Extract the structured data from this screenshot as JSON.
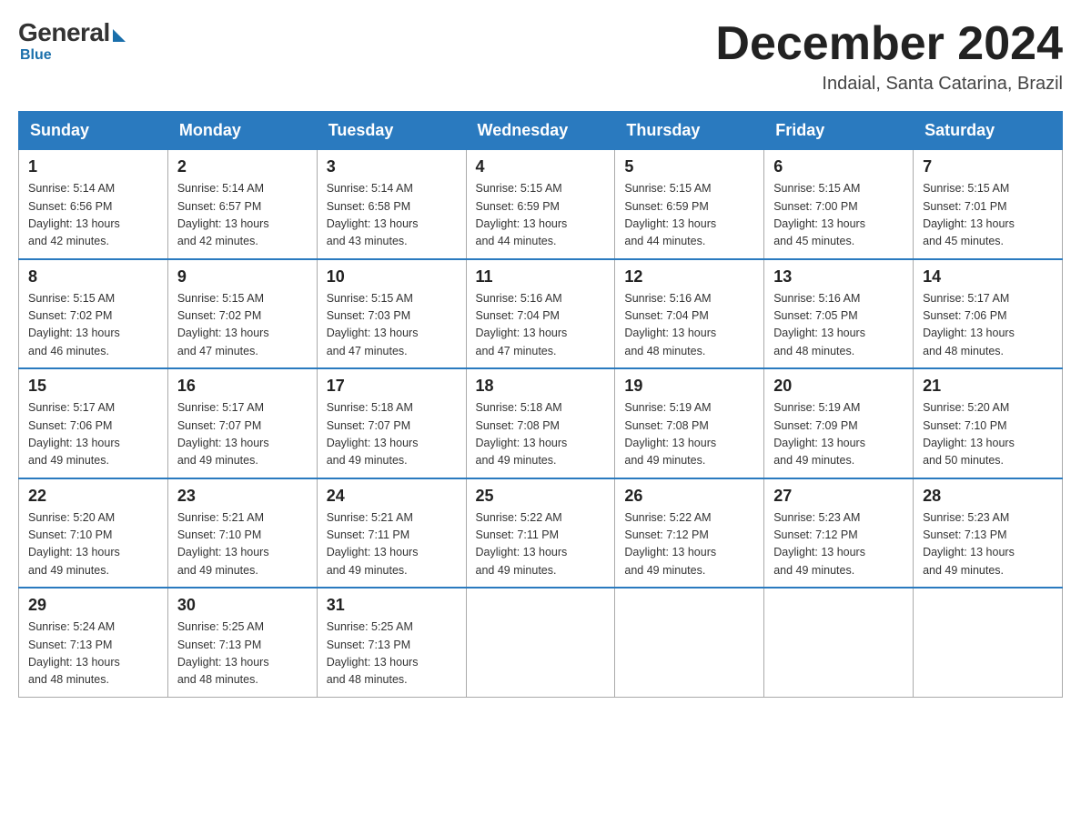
{
  "header": {
    "logo_general": "General",
    "logo_blue": "Blue",
    "month_title": "December 2024",
    "location": "Indaial, Santa Catarina, Brazil"
  },
  "days_of_week": [
    "Sunday",
    "Monday",
    "Tuesday",
    "Wednesday",
    "Thursday",
    "Friday",
    "Saturday"
  ],
  "weeks": [
    [
      {
        "day": "1",
        "sunrise": "5:14 AM",
        "sunset": "6:56 PM",
        "daylight": "13 hours and 42 minutes."
      },
      {
        "day": "2",
        "sunrise": "5:14 AM",
        "sunset": "6:57 PM",
        "daylight": "13 hours and 42 minutes."
      },
      {
        "day": "3",
        "sunrise": "5:14 AM",
        "sunset": "6:58 PM",
        "daylight": "13 hours and 43 minutes."
      },
      {
        "day": "4",
        "sunrise": "5:15 AM",
        "sunset": "6:59 PM",
        "daylight": "13 hours and 44 minutes."
      },
      {
        "day": "5",
        "sunrise": "5:15 AM",
        "sunset": "6:59 PM",
        "daylight": "13 hours and 44 minutes."
      },
      {
        "day": "6",
        "sunrise": "5:15 AM",
        "sunset": "7:00 PM",
        "daylight": "13 hours and 45 minutes."
      },
      {
        "day": "7",
        "sunrise": "5:15 AM",
        "sunset": "7:01 PM",
        "daylight": "13 hours and 45 minutes."
      }
    ],
    [
      {
        "day": "8",
        "sunrise": "5:15 AM",
        "sunset": "7:02 PM",
        "daylight": "13 hours and 46 minutes."
      },
      {
        "day": "9",
        "sunrise": "5:15 AM",
        "sunset": "7:02 PM",
        "daylight": "13 hours and 47 minutes."
      },
      {
        "day": "10",
        "sunrise": "5:15 AM",
        "sunset": "7:03 PM",
        "daylight": "13 hours and 47 minutes."
      },
      {
        "day": "11",
        "sunrise": "5:16 AM",
        "sunset": "7:04 PM",
        "daylight": "13 hours and 47 minutes."
      },
      {
        "day": "12",
        "sunrise": "5:16 AM",
        "sunset": "7:04 PM",
        "daylight": "13 hours and 48 minutes."
      },
      {
        "day": "13",
        "sunrise": "5:16 AM",
        "sunset": "7:05 PM",
        "daylight": "13 hours and 48 minutes."
      },
      {
        "day": "14",
        "sunrise": "5:17 AM",
        "sunset": "7:06 PM",
        "daylight": "13 hours and 48 minutes."
      }
    ],
    [
      {
        "day": "15",
        "sunrise": "5:17 AM",
        "sunset": "7:06 PM",
        "daylight": "13 hours and 49 minutes."
      },
      {
        "day": "16",
        "sunrise": "5:17 AM",
        "sunset": "7:07 PM",
        "daylight": "13 hours and 49 minutes."
      },
      {
        "day": "17",
        "sunrise": "5:18 AM",
        "sunset": "7:07 PM",
        "daylight": "13 hours and 49 minutes."
      },
      {
        "day": "18",
        "sunrise": "5:18 AM",
        "sunset": "7:08 PM",
        "daylight": "13 hours and 49 minutes."
      },
      {
        "day": "19",
        "sunrise": "5:19 AM",
        "sunset": "7:08 PM",
        "daylight": "13 hours and 49 minutes."
      },
      {
        "day": "20",
        "sunrise": "5:19 AM",
        "sunset": "7:09 PM",
        "daylight": "13 hours and 49 minutes."
      },
      {
        "day": "21",
        "sunrise": "5:20 AM",
        "sunset": "7:10 PM",
        "daylight": "13 hours and 50 minutes."
      }
    ],
    [
      {
        "day": "22",
        "sunrise": "5:20 AM",
        "sunset": "7:10 PM",
        "daylight": "13 hours and 49 minutes."
      },
      {
        "day": "23",
        "sunrise": "5:21 AM",
        "sunset": "7:10 PM",
        "daylight": "13 hours and 49 minutes."
      },
      {
        "day": "24",
        "sunrise": "5:21 AM",
        "sunset": "7:11 PM",
        "daylight": "13 hours and 49 minutes."
      },
      {
        "day": "25",
        "sunrise": "5:22 AM",
        "sunset": "7:11 PM",
        "daylight": "13 hours and 49 minutes."
      },
      {
        "day": "26",
        "sunrise": "5:22 AM",
        "sunset": "7:12 PM",
        "daylight": "13 hours and 49 minutes."
      },
      {
        "day": "27",
        "sunrise": "5:23 AM",
        "sunset": "7:12 PM",
        "daylight": "13 hours and 49 minutes."
      },
      {
        "day": "28",
        "sunrise": "5:23 AM",
        "sunset": "7:13 PM",
        "daylight": "13 hours and 49 minutes."
      }
    ],
    [
      {
        "day": "29",
        "sunrise": "5:24 AM",
        "sunset": "7:13 PM",
        "daylight": "13 hours and 48 minutes."
      },
      {
        "day": "30",
        "sunrise": "5:25 AM",
        "sunset": "7:13 PM",
        "daylight": "13 hours and 48 minutes."
      },
      {
        "day": "31",
        "sunrise": "5:25 AM",
        "sunset": "7:13 PM",
        "daylight": "13 hours and 48 minutes."
      },
      null,
      null,
      null,
      null
    ]
  ],
  "labels": {
    "sunrise": "Sunrise:",
    "sunset": "Sunset:",
    "daylight": "Daylight:"
  }
}
